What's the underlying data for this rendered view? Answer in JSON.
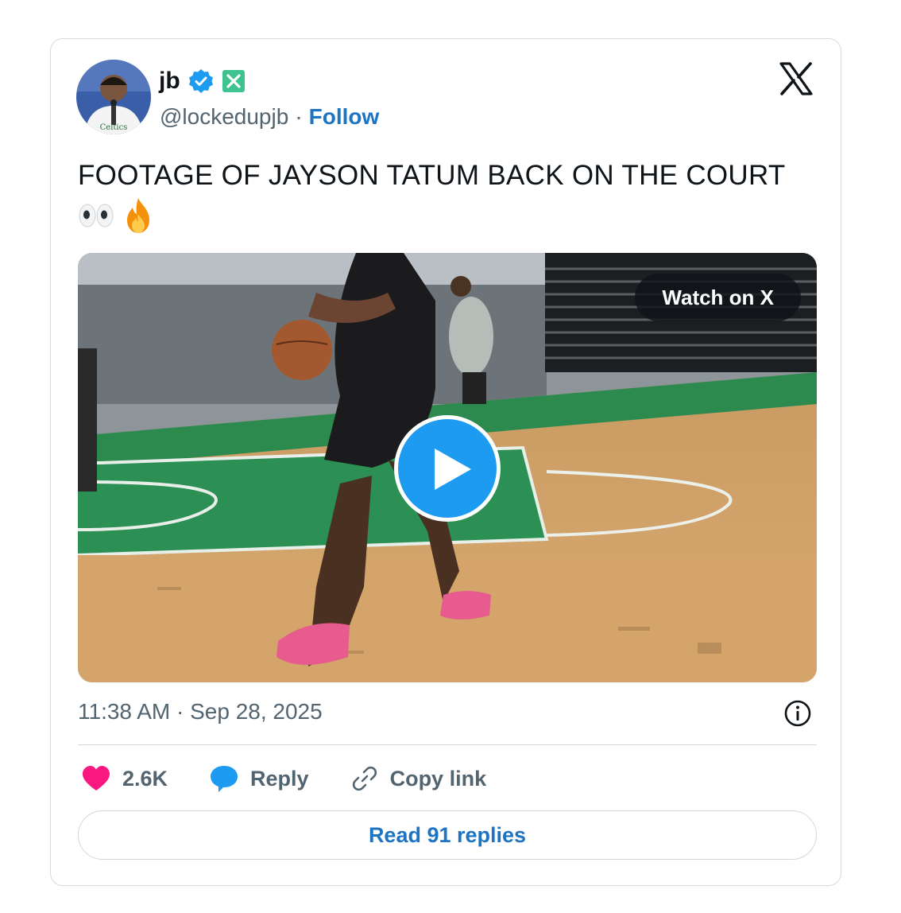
{
  "author": {
    "display_name": "jb",
    "handle": "@lockedupjb",
    "separator": "·",
    "follow_label": "Follow"
  },
  "tweet": {
    "text": "FOOTAGE OF JAYSON TATUM BACK ON THE COURT",
    "emoji": "👀🔥",
    "timestamp": "11:38 AM · Sep 28, 2025"
  },
  "media": {
    "watch_label": "Watch on X"
  },
  "actions": {
    "likes": "2.6K",
    "reply_label": "Reply",
    "copy_label": "Copy link"
  },
  "read_replies_label": "Read 91 replies",
  "colors": {
    "accent": "#1d9bf0",
    "link": "#1d74c2",
    "like": "#f91880",
    "muted": "#536471"
  }
}
